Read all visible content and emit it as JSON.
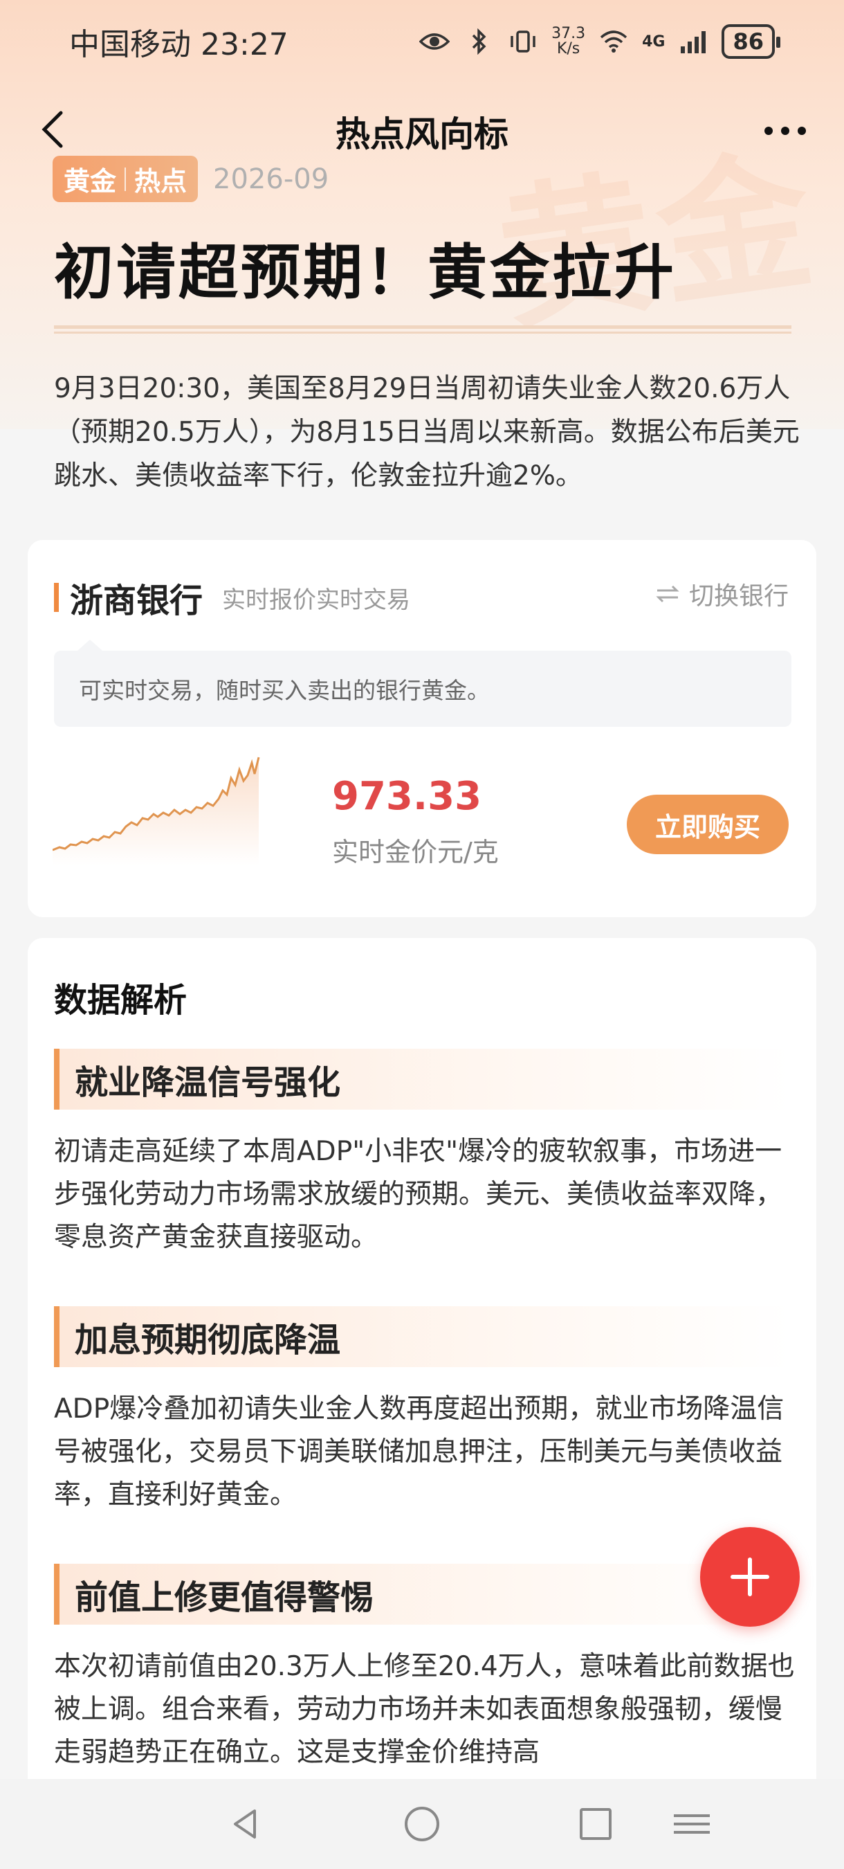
{
  "status_bar": {
    "carrier": "中国移动",
    "time": "23:27",
    "net_speed_value": "37.3",
    "net_speed_unit": "K/s",
    "network": "4G",
    "battery": "86"
  },
  "nav": {
    "title": "热点风向标"
  },
  "header": {
    "tag_left": "黄金",
    "tag_right": "热点",
    "date": "2026-09",
    "headline": "初请超预期！黄金拉升",
    "summary": "9月3日20:30，美国至8月29日当周初请失业金人数20.6万人（预期20.5万人），为8月15日当周以来新高。数据公布后美元跳水、美债收益率下行，伦敦金拉升逾2%。",
    "watermark": "黄金"
  },
  "bank": {
    "name": "浙商银行",
    "subtitle": "实时报价实时交易",
    "switch_label": "切换银行",
    "hint": "可实时交易，随时买入卖出的银行黄金。",
    "price": "973.33",
    "price_unit": "实时金价元/克",
    "buy_label": "立即购买",
    "accent_color": "#e0944f"
  },
  "analysis": {
    "title": "数据解析",
    "sections": [
      {
        "heading": "就业降温信号强化",
        "body": "初请走高延续了本周ADP\"小非农\"爆冷的疲软叙事，市场进一步强化劳动力市场需求放缓的预期。美元、美债收益率双降，零息资产黄金获直接驱动。"
      },
      {
        "heading": "加息预期彻底降温",
        "body": "ADP爆冷叠加初请失业金人数再度超出预期，就业市场降温信号被强化，交易员下调美联储加息押注，压制美元与美债收益率，直接利好黄金。"
      },
      {
        "heading": "前值上修更值得警惕",
        "body": "本次初请前值由20.3万人上修至20.4万人，意味着此前数据也被上调。组合来看，劳动力市场并未如表面想象般强韧，缓慢走弱趋势正在确立。这是支撑金价维持高"
      }
    ]
  },
  "icons": {
    "back": "back-arrow-icon",
    "more": "more-dots-icon",
    "switch": "switch-arrows-icon",
    "fab": "plus-icon"
  }
}
